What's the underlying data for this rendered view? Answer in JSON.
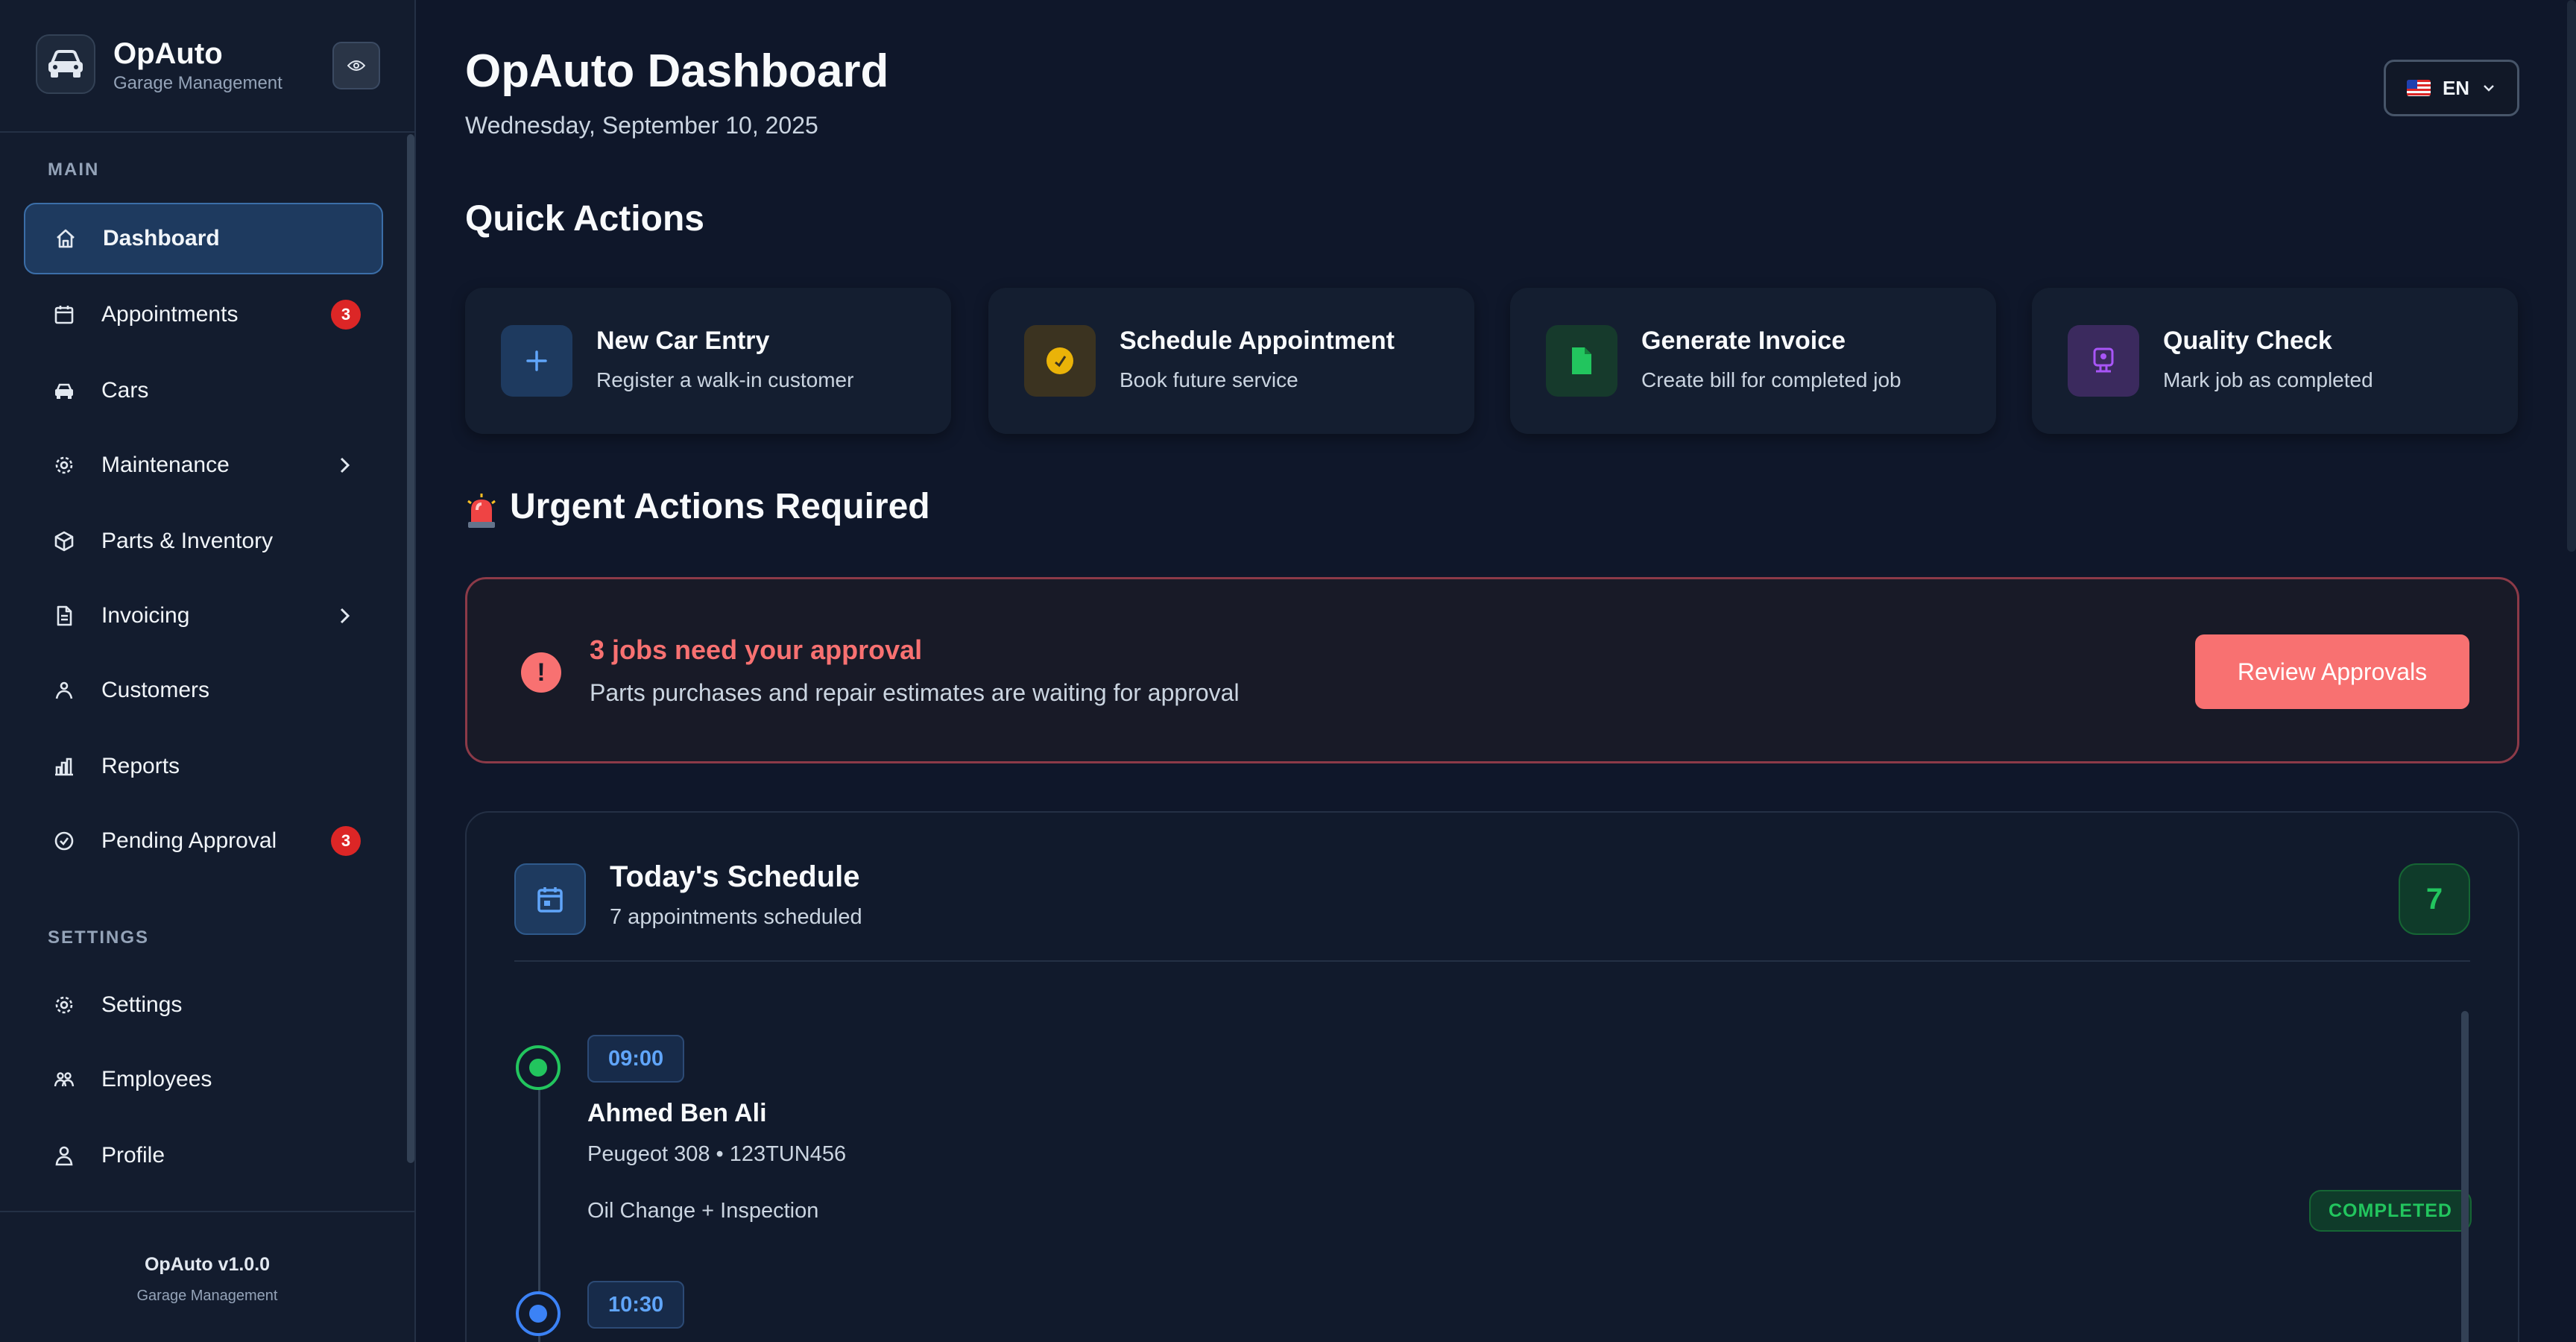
{
  "brand": {
    "name": "OpAuto",
    "subtitle": "Garage Management"
  },
  "sidebar": {
    "sections": {
      "main": "MAIN",
      "settings": "SETTINGS"
    },
    "items": [
      {
        "label": "Dashboard",
        "icon": "home-icon",
        "active": true
      },
      {
        "label": "Appointments",
        "icon": "calendar-icon",
        "badge": "3"
      },
      {
        "label": "Cars",
        "icon": "car-icon"
      },
      {
        "label": "Maintenance",
        "icon": "gear-icon",
        "expandable": true
      },
      {
        "label": "Parts & Inventory",
        "icon": "box-icon"
      },
      {
        "label": "Invoicing",
        "icon": "document-icon",
        "expandable": true
      },
      {
        "label": "Customers",
        "icon": "customers-icon"
      },
      {
        "label": "Reports",
        "icon": "bar-chart-icon"
      },
      {
        "label": "Pending Approval",
        "icon": "check-circle-icon",
        "badge": "3"
      },
      {
        "label": "Settings",
        "icon": "gear-icon"
      },
      {
        "label": "Employees",
        "icon": "team-icon"
      },
      {
        "label": "Profile",
        "icon": "user-icon"
      }
    ],
    "footer": {
      "version": "OpAuto v1.0.0",
      "subtitle": "Garage Management"
    }
  },
  "header": {
    "title": "OpAuto Dashboard",
    "date": "Wednesday, September 10, 2025",
    "language": "EN"
  },
  "quick_actions": {
    "title": "Quick Actions",
    "items": [
      {
        "title": "New Car Entry",
        "subtitle": "Register a walk-in customer",
        "icon": "plus-icon",
        "color": "#60a5fa"
      },
      {
        "title": "Schedule Appointment",
        "subtitle": "Book future service",
        "icon": "clock-icon",
        "color": "#eab308"
      },
      {
        "title": "Generate Invoice",
        "subtitle": "Create bill for completed job",
        "icon": "file-icon",
        "color": "#22c55e"
      },
      {
        "title": "Quality Check",
        "subtitle": "Mark job as completed",
        "icon": "inspection-icon",
        "color": "#a855f7"
      }
    ]
  },
  "urgent": {
    "title": "Urgent Actions Required",
    "alert_title": "3 jobs need your approval",
    "alert_subtitle": "Parts purchases and repair estimates are waiting for approval",
    "button": "Review Approvals",
    "accent": "#f87171"
  },
  "schedule": {
    "title": "Today's Schedule",
    "subtitle": "7 appointments scheduled",
    "count": "7",
    "appointments": [
      {
        "time": "09:00",
        "customer": "Ahmed Ben Ali",
        "car": "Peugeot 308 • 123TUN456",
        "service": "Oil Change + Inspection",
        "status": "COMPLETED",
        "dot_color": "#22c55e"
      },
      {
        "time": "10:30",
        "dot_color": "#3b82f6"
      }
    ]
  }
}
